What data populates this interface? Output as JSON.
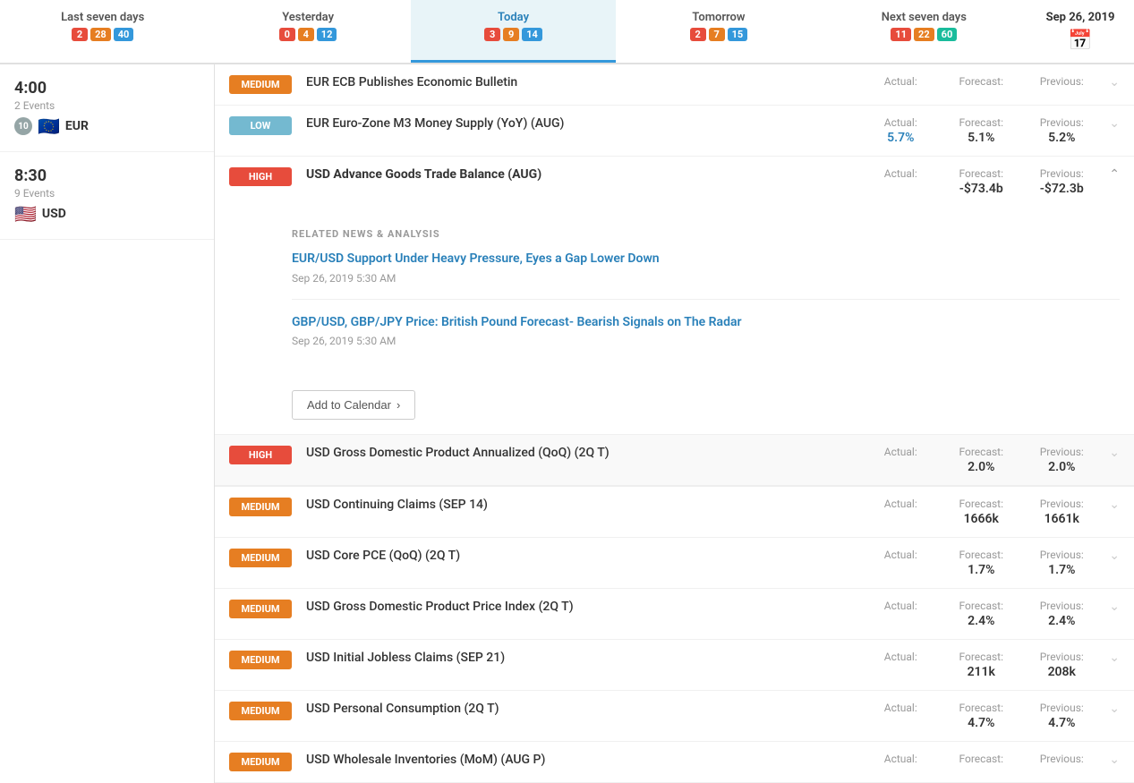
{
  "topNav": {
    "tabs": [
      {
        "id": "last-seven-days",
        "label": "Last seven days",
        "active": false,
        "badges": [
          {
            "value": "2",
            "color": "red"
          },
          {
            "value": "28",
            "color": "orange"
          },
          {
            "value": "40",
            "color": "blue"
          }
        ]
      },
      {
        "id": "yesterday",
        "label": "Yesterday",
        "active": false,
        "badges": [
          {
            "value": "0",
            "color": "red"
          },
          {
            "value": "4",
            "color": "orange"
          },
          {
            "value": "12",
            "color": "blue"
          }
        ]
      },
      {
        "id": "today",
        "label": "Today",
        "active": true,
        "badges": [
          {
            "value": "3",
            "color": "red"
          },
          {
            "value": "9",
            "color": "orange"
          },
          {
            "value": "14",
            "color": "blue"
          }
        ]
      },
      {
        "id": "tomorrow",
        "label": "Tomorrow",
        "active": false,
        "badges": [
          {
            "value": "2",
            "color": "red"
          },
          {
            "value": "7",
            "color": "orange"
          },
          {
            "value": "15",
            "color": "blue"
          }
        ]
      },
      {
        "id": "next-seven-days",
        "label": "Next seven days",
        "active": false,
        "badges": [
          {
            "value": "11",
            "color": "red"
          },
          {
            "value": "22",
            "color": "orange"
          },
          {
            "value": "60",
            "color": "teal"
          }
        ]
      }
    ],
    "calendarDate": "Sep 26, 2019"
  },
  "timeBlocks": [
    {
      "time": "4:00",
      "events": "2 Events",
      "currencyFlag": "🇪🇺",
      "currencyLabel": "EUR",
      "currencyBadgeCount": "10"
    },
    {
      "time": "8:30",
      "events": "9 Events",
      "currencyFlag": "🇺🇸",
      "currencyLabel": "USD",
      "currencyBadgeCount": ""
    }
  ],
  "events": [
    {
      "id": "eur-ecb",
      "impact": "MEDIUM",
      "impactClass": "medium",
      "name": "EUR ECB Publishes Economic Bulletin",
      "actual_label": "Actual:",
      "actual_value": "",
      "forecast_label": "Forecast:",
      "forecast_value": "",
      "previous_label": "Previous:",
      "previous_value": "",
      "expanded": false,
      "timeBlock": 0
    },
    {
      "id": "eur-m3",
      "impact": "LOW",
      "impactClass": "low",
      "name": "EUR Euro-Zone M3 Money Supply (YoY) (AUG)",
      "actual_label": "Actual:",
      "actual_value": "5.7%",
      "actual_blue": true,
      "forecast_label": "Forecast:",
      "forecast_value": "5.1%",
      "previous_label": "Previous:",
      "previous_value": "5.2%",
      "expanded": false,
      "timeBlock": 0
    },
    {
      "id": "usd-advance-goods",
      "impact": "HIGH",
      "impactClass": "high",
      "name": "USD Advance Goods Trade Balance (AUG)",
      "actual_label": "Actual:",
      "actual_value": "",
      "forecast_label": "Forecast:",
      "forecast_value": "-$73.4b",
      "previous_label": "Previous:",
      "previous_value": "-$72.3b",
      "expanded": true,
      "relatedNews": [
        {
          "title": "EUR/USD Support Under Heavy Pressure, Eyes a Gap Lower Down",
          "date": "Sep 26, 2019 5:30 AM"
        },
        {
          "title": "GBP/USD, GBP/JPY Price: British Pound Forecast- Bearish Signals on The Radar",
          "date": "Sep 26, 2019 5:30 AM"
        }
      ],
      "timeBlock": 1
    },
    {
      "id": "usd-gdp-annualized",
      "impact": "HIGH",
      "impactClass": "high",
      "name": "USD Gross Domestic Product Annualized (QoQ) (2Q T)",
      "actual_label": "Actual:",
      "actual_value": "",
      "forecast_label": "Forecast:",
      "forecast_value": "2.0%",
      "previous_label": "Previous:",
      "previous_value": "2.0%",
      "expanded": false,
      "timeBlock": 1
    },
    {
      "id": "usd-continuing-claims",
      "impact": "MEDIUM",
      "impactClass": "medium",
      "name": "USD Continuing Claims (SEP 14)",
      "actual_label": "Actual:",
      "actual_value": "",
      "forecast_label": "Forecast:",
      "forecast_value": "1666k",
      "previous_label": "Previous:",
      "previous_value": "1661k",
      "expanded": false,
      "timeBlock": 1
    },
    {
      "id": "usd-core-pce",
      "impact": "MEDIUM",
      "impactClass": "medium",
      "name": "USD Core PCE (QoQ) (2Q T)",
      "actual_label": "Actual:",
      "actual_value": "",
      "forecast_label": "Forecast:",
      "forecast_value": "1.7%",
      "previous_label": "Previous:",
      "previous_value": "1.7%",
      "expanded": false,
      "timeBlock": 1
    },
    {
      "id": "usd-gdp-price-index",
      "impact": "MEDIUM",
      "impactClass": "medium",
      "name": "USD Gross Domestic Product Price Index (2Q T)",
      "actual_label": "Actual:",
      "actual_value": "",
      "forecast_label": "Forecast:",
      "forecast_value": "2.4%",
      "previous_label": "Previous:",
      "previous_value": "2.4%",
      "expanded": false,
      "timeBlock": 1
    },
    {
      "id": "usd-initial-jobless",
      "impact": "MEDIUM",
      "impactClass": "medium",
      "name": "USD Initial Jobless Claims (SEP 21)",
      "actual_label": "Actual:",
      "actual_value": "",
      "forecast_label": "Forecast:",
      "forecast_value": "211k",
      "previous_label": "Previous:",
      "previous_value": "208k",
      "expanded": false,
      "timeBlock": 1
    },
    {
      "id": "usd-personal-consumption",
      "impact": "MEDIUM",
      "impactClass": "medium",
      "name": "USD Personal Consumption (2Q T)",
      "actual_label": "Actual:",
      "actual_value": "",
      "forecast_label": "Forecast:",
      "forecast_value": "4.7%",
      "previous_label": "Previous:",
      "previous_value": "4.7%",
      "expanded": false,
      "timeBlock": 1
    },
    {
      "id": "usd-wholesale-inventories",
      "impact": "MEDIUM",
      "impactClass": "medium",
      "name": "USD Wholesale Inventories (MoM) (AUG P)",
      "actual_label": "Actual:",
      "actual_value": "",
      "forecast_label": "Forecast:",
      "forecast_value": "",
      "previous_label": "Previous:",
      "previous_value": "",
      "expanded": false,
      "timeBlock": 1
    }
  ],
  "addToCalendar": {
    "label": "Add to Calendar"
  },
  "relatedNewsTitle": "RELATED NEWS & ANALYSIS"
}
